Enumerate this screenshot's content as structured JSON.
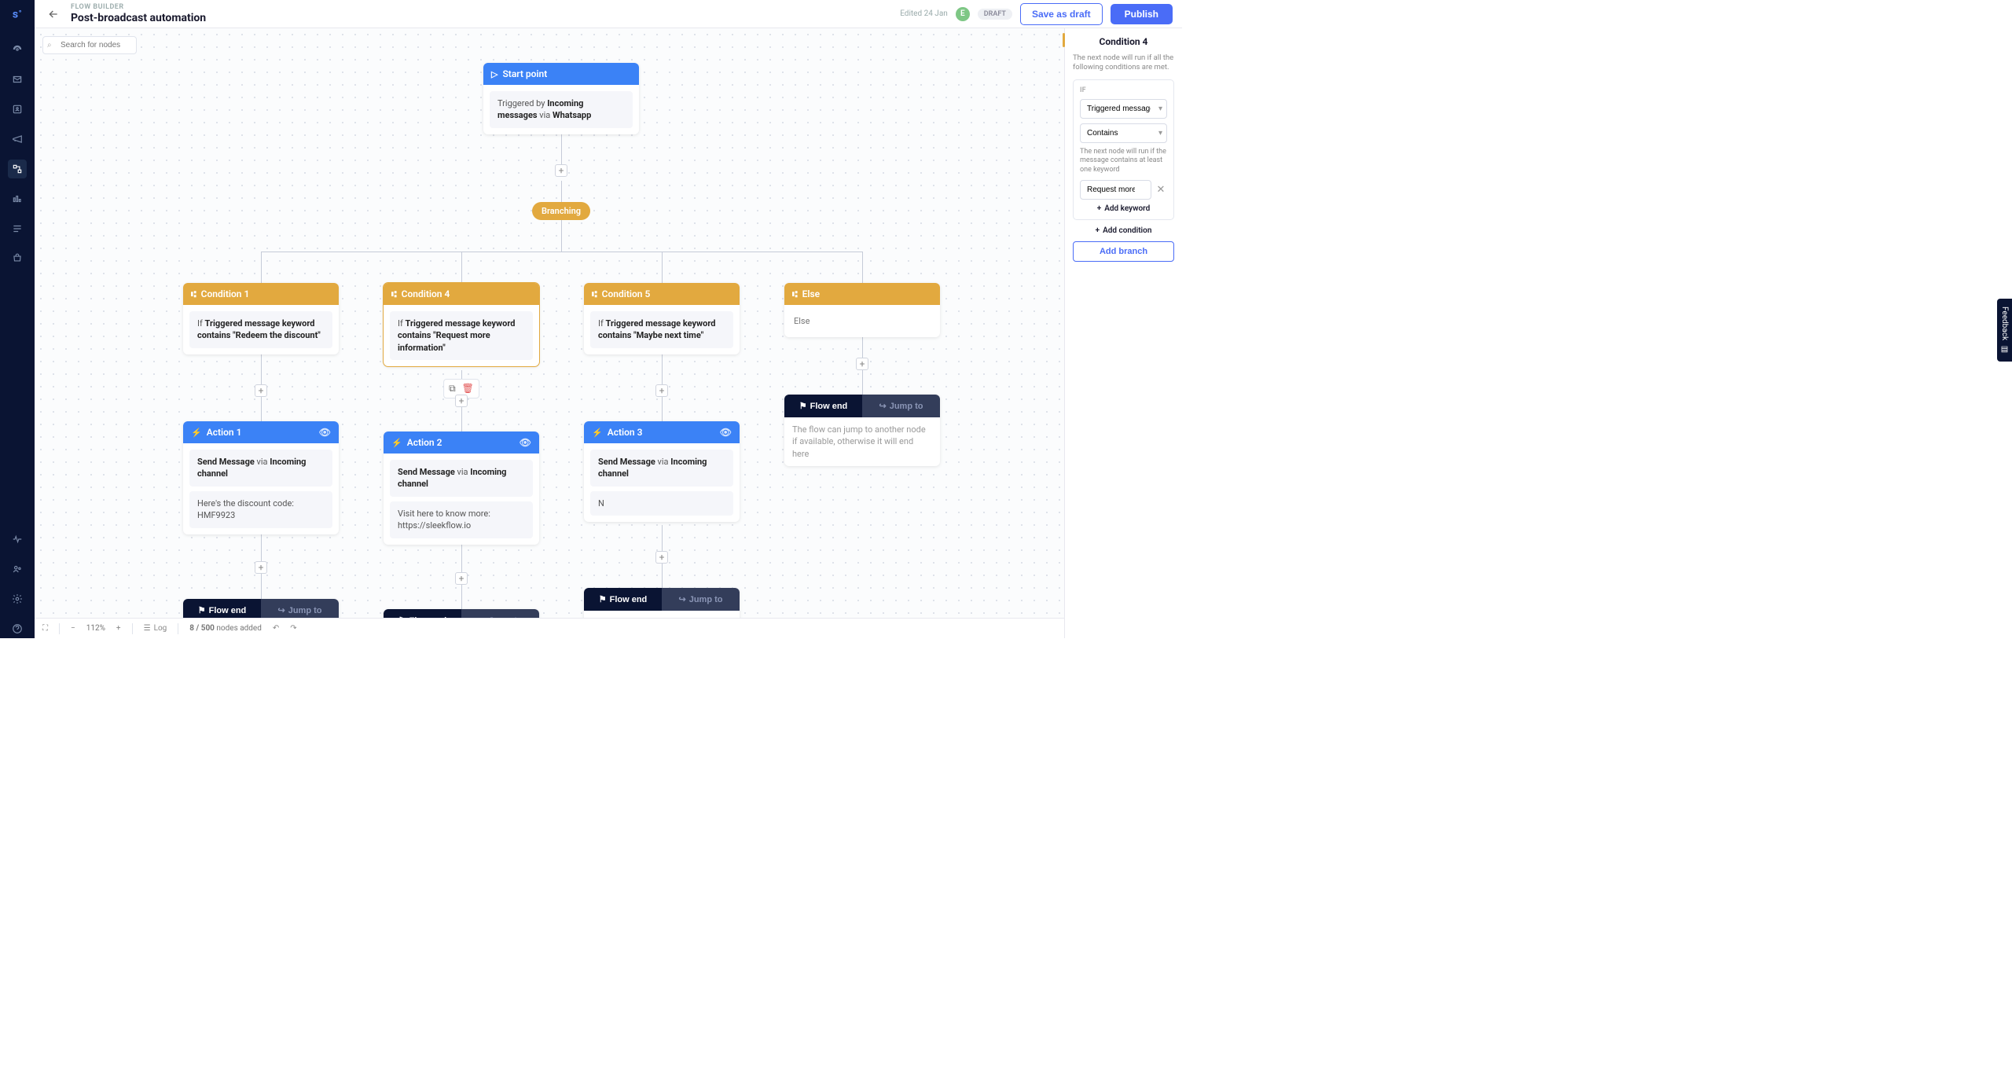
{
  "header": {
    "breadcrumb": "FLOW BUILDER",
    "title": "Post-broadcast automation",
    "edited": "Edited 24 Jan",
    "avatar_initial": "E",
    "draft_badge": "DRAFT",
    "save_draft": "Save as draft",
    "publish": "Publish"
  },
  "search": {
    "placeholder": "Search for nodes"
  },
  "nodes": {
    "start": {
      "title": "Start point",
      "body_pre": "Triggered by ",
      "body_strong1": "Incoming messages",
      "body_mid": " via ",
      "body_strong2": "Whatsapp"
    },
    "branching": "Branching",
    "cond1": {
      "title": "Condition 1",
      "body_pre": "If ",
      "body_strong": "Triggered message keyword contains \"Redeem the discount\""
    },
    "cond4": {
      "title": "Condition 4",
      "body_pre": "If ",
      "body_strong": "Triggered message keyword contains \"Request more information\""
    },
    "cond5": {
      "title": "Condition 5",
      "body_pre": "If ",
      "body_strong": "Triggered message keyword contains \"Maybe next time\""
    },
    "else": {
      "title": "Else",
      "body": "Else"
    },
    "action1": {
      "title": "Action 1",
      "send_pre": "Send Message",
      "send_mid": " via ",
      "send_strong": "Incoming channel",
      "msg": "Here's the discount code: HMF9923"
    },
    "action2": {
      "title": "Action 2",
      "send_pre": "Send Message",
      "send_mid": " via ",
      "send_strong": "Incoming channel",
      "msg": "Visit here to know more: https://sleekflow.io"
    },
    "action3": {
      "title": "Action 3",
      "send_pre": "Send Message",
      "send_mid": " via ",
      "send_strong": "Incoming channel",
      "msg": "N"
    },
    "flow_end": {
      "end": "Flow end",
      "jump": "Jump to",
      "note": "The flow can jump to another node if available, otherwise it will end here"
    }
  },
  "panel": {
    "title": "Condition 4",
    "desc": "The next node will run if all the following conditions are met.",
    "if_label": "IF",
    "field": "Triggered message keyword",
    "operator": "Contains",
    "note": "The next node will run if the message contains at least one keyword",
    "keyword": "Request more information",
    "add_keyword": "Add keyword",
    "add_condition": "Add condition",
    "add_branch": "Add branch"
  },
  "footer": {
    "zoom": "112%",
    "log": "Log",
    "nodes_count": "8 / 500",
    "nodes_suffix": " nodes added"
  },
  "feedback": "Feedback"
}
